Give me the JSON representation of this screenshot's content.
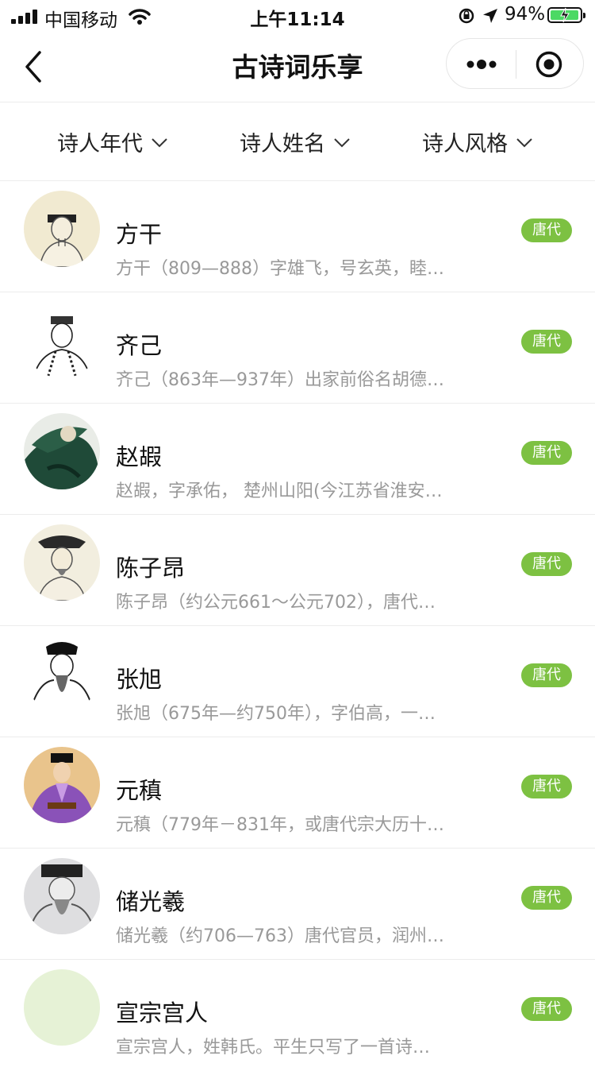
{
  "status_bar": {
    "carrier": "中国移动",
    "time": "上午11:14",
    "battery": "94%",
    "battery_level": 0.94,
    "charging_color": "#4cd964"
  },
  "nav": {
    "title": "古诗词乐享",
    "icons": [
      "back-icon",
      "more-icon",
      "target-icon"
    ]
  },
  "filters": [
    {
      "label": "诗人年代"
    },
    {
      "label": "诗人姓名"
    },
    {
      "label": "诗人风格"
    }
  ],
  "theme": {
    "badge_color": "#7dc142",
    "desc_color": "#999999"
  },
  "poets": [
    {
      "name": "方干",
      "desc": "方干（809—888）字雄飞，号玄英，睦…",
      "era": "唐代"
    },
    {
      "name": "齐己",
      "desc": "齐己（863年—937年）出家前俗名胡德…",
      "era": "唐代"
    },
    {
      "name": "赵嘏",
      "desc": "赵嘏，字承佑，  楚州山阳(今江苏省淮安…",
      "era": "唐代"
    },
    {
      "name": "陈子昂",
      "desc": "陈子昂（约公元661～公元702），唐代…",
      "era": "唐代"
    },
    {
      "name": "张旭",
      "desc": "张旭（675年—约750年），字伯高，一…",
      "era": "唐代"
    },
    {
      "name": "元稹",
      "desc": "元稹（779年－831年，或唐代宗大历十…",
      "era": "唐代"
    },
    {
      "name": "储光羲",
      "desc": "储光羲（约706—763）唐代官员，润州…",
      "era": "唐代"
    },
    {
      "name": "宣宗宫人",
      "desc": "宣宗宫人，姓韩氏。平生只写了一首诗…",
      "era": "唐代"
    }
  ]
}
